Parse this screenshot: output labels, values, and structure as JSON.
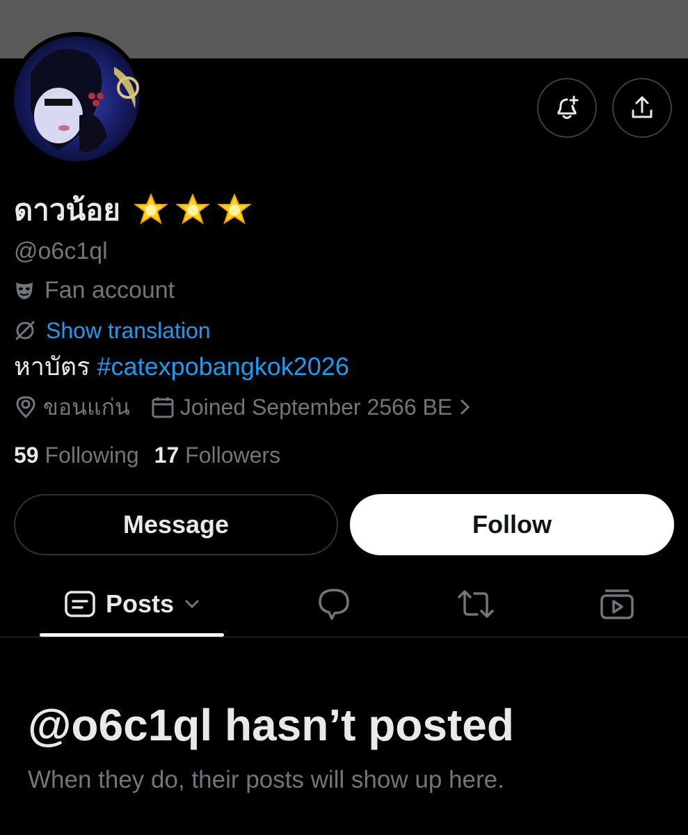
{
  "profile": {
    "display_name": "ดาวน้อย",
    "name_emoji": [
      "star-emoji",
      "star-emoji",
      "star-emoji"
    ],
    "handle": "@o6c1ql",
    "category": "Fan account",
    "translate_label": "Show translation",
    "bio_text": "หาบัตร",
    "bio_hashtag": "#catexpobangkok2026",
    "location": "ขอนแก่น",
    "joined": "Joined September 2566 BE",
    "following_count": "59",
    "following_label": "Following",
    "followers_count": "17",
    "followers_label": "Followers"
  },
  "actions": {
    "message_label": "Message",
    "follow_label": "Follow",
    "notify_icon": "bell-plus-icon",
    "share_icon": "share-icon"
  },
  "tabs": [
    {
      "label": "Posts",
      "icon": "posts-icon",
      "active": true
    },
    {
      "label": "",
      "icon": "replies-icon"
    },
    {
      "label": "",
      "icon": "reposts-icon"
    },
    {
      "label": "",
      "icon": "media-icon"
    }
  ],
  "empty_state": {
    "title": "@o6c1ql hasn’t posted",
    "subtitle": "When they do, their posts will show up here."
  },
  "colors": {
    "background": "#000000",
    "banner": "#5a5a5a",
    "text_primary": "#e7e9ea",
    "text_secondary": "#71767b",
    "link": "#1d9bf0",
    "border": "#2f3336"
  }
}
